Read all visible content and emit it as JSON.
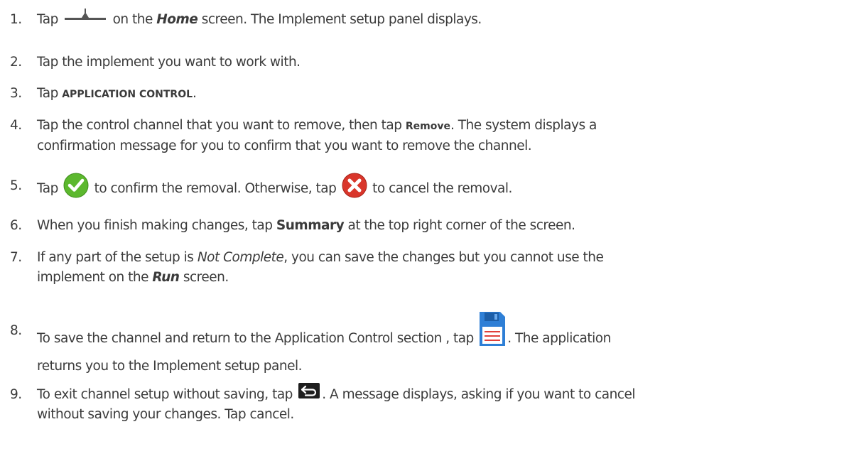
{
  "steps": [
    {
      "num": "1.",
      "t1": "Tap",
      "t2": "on the",
      "em": "Home",
      "t3": "screen. The Implement setup panel displays."
    },
    {
      "num": "2.",
      "t1": "Tap the implement you want to work with."
    },
    {
      "num": "3.",
      "t1": "Tap",
      "strong": "APPLICATION CONTROL",
      "t2": "."
    },
    {
      "num": "4.",
      "t1": "Tap the control channel that you want to remove, then tap",
      "strong": "Remove",
      "t2": ". The system displays a",
      "line2": "confirmation message for you to confirm that you want to remove the channel."
    },
    {
      "num": "5.",
      "t1": "Tap",
      "t2": "to confirm the removal. Otherwise, tap",
      "t3": "to cancel the removal."
    },
    {
      "num": "6.",
      "t1": "When you finish making changes, tap",
      "strong": "Summary",
      "t2": "at the top right corner of the screen."
    },
    {
      "num": "7.",
      "t1": "If any part of the setup is",
      "em": "Not Complete",
      "t2": ", you can save the changes but you cannot use the",
      "line2a": "implement on the",
      "em2": "Run",
      "line2b": "screen."
    },
    {
      "num": "8.",
      "t1": "To save the channel and return to the Application Control section , tap",
      "t2": ". The application",
      "line2": "returns you to the Implement setup panel."
    },
    {
      "num": "9.",
      "t1": "To exit channel setup without saving, tap",
      "t2": ". A message displays, asking if you want to cancel",
      "line2": "without saving your changes. Tap cancel."
    }
  ],
  "icons": {
    "implement": "implement-icon",
    "confirm": "checkmark-icon",
    "cancel": "cancel-x-icon",
    "save": "save-disk-icon",
    "back": "back-arrow-icon"
  },
  "colors": {
    "text": "#3b3b3b",
    "confirm_green": "#5cb82e",
    "cancel_red": "#d9362b",
    "save_blue": "#2e7fd6"
  }
}
